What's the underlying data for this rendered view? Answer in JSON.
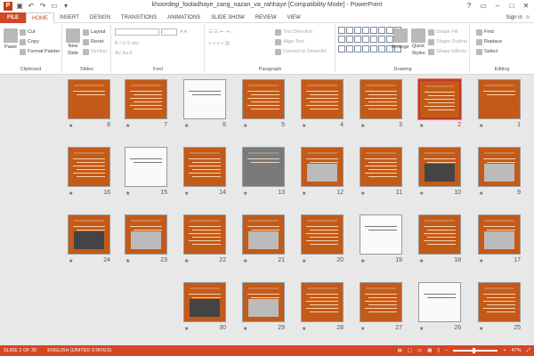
{
  "window": {
    "title": "khoordegi_fooladhaye_zang_nazan_va_rahhaye [Compatibility Mode] - PowerPoint",
    "signin": "Sign in"
  },
  "tabs": [
    "FILE",
    "HOME",
    "INSERT",
    "DESIGN",
    "TRANSITIONS",
    "ANIMATIONS",
    "SLIDE SHOW",
    "REVIEW",
    "VIEW"
  ],
  "ribbon": {
    "clipboard": {
      "label": "Clipboard",
      "paste": "Paste",
      "cut": "Cut",
      "copy": "Copy",
      "format_painter": "Format Painter"
    },
    "slides": {
      "label": "Slides",
      "new_slide": "New",
      "new_slide2": "Slide",
      "layout": "Layout",
      "reset": "Reset",
      "section": "Section"
    },
    "font": {
      "label": "Font"
    },
    "paragraph": {
      "label": "Paragraph",
      "text_direction": "Text Direction",
      "align_text": "Align Text",
      "convert": "Convert to SmartArt"
    },
    "drawing": {
      "label": "Drawing",
      "arrange": "Arrange",
      "quick_styles": "Quick",
      "quick_styles2": "Styles",
      "shape_fill": "Shape Fill",
      "shape_outline": "Shape Outline",
      "shape_effects": "Shape Effects"
    },
    "editing": {
      "label": "Editing",
      "find": "Find",
      "replace": "Replace",
      "select": "Select"
    }
  },
  "slides": [
    {
      "n": "1",
      "sel": false
    },
    {
      "n": "2",
      "sel": true
    },
    {
      "n": "3",
      "sel": false
    },
    {
      "n": "4",
      "sel": false
    },
    {
      "n": "5",
      "sel": false
    },
    {
      "n": "6",
      "sel": false
    },
    {
      "n": "7",
      "sel": false
    },
    {
      "n": "8",
      "sel": false
    },
    {
      "n": "9"
    },
    {
      "n": "10"
    },
    {
      "n": "11"
    },
    {
      "n": "12"
    },
    {
      "n": "13"
    },
    {
      "n": "14"
    },
    {
      "n": "15"
    },
    {
      "n": "16"
    },
    {
      "n": "17"
    },
    {
      "n": "18"
    },
    {
      "n": "19"
    },
    {
      "n": "20"
    },
    {
      "n": "21"
    },
    {
      "n": "22"
    },
    {
      "n": "23"
    },
    {
      "n": "24"
    },
    {
      "n": "25"
    },
    {
      "n": "26"
    },
    {
      "n": "27"
    },
    {
      "n": "28"
    },
    {
      "n": "29"
    },
    {
      "n": "30"
    }
  ],
  "status": {
    "slide": "SLIDE 2 OF 30",
    "language": "ENGLISH (UNITED STATES)",
    "zoom": "47%"
  },
  "colors": {
    "accent": "#d24726",
    "slide_bg": "#c45a18",
    "selected": "#c1392b"
  }
}
